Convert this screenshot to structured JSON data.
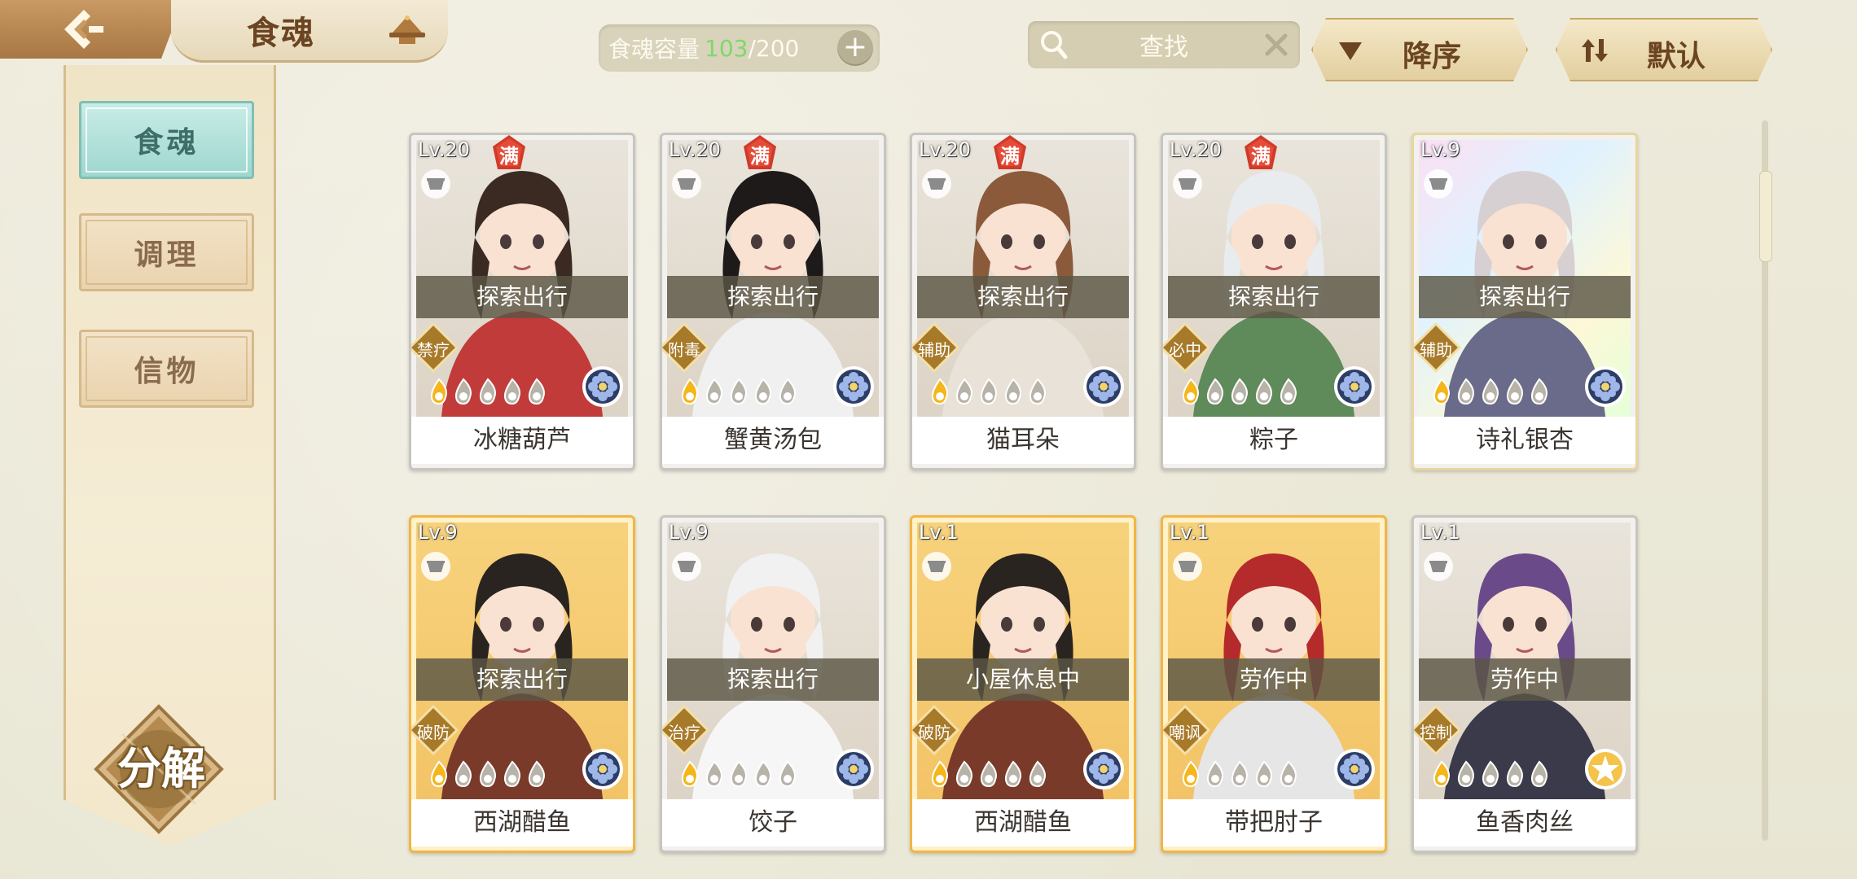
{
  "header": {
    "title": "食魂",
    "capacity_label": "食魂容量",
    "capacity_current": "103",
    "capacity_max": "/200",
    "search_placeholder": "查找",
    "sort_order_label": "降序",
    "sort_default_label": "默认"
  },
  "sidebar": {
    "items": [
      {
        "label": "食魂",
        "active": true
      },
      {
        "label": "调理",
        "active": false
      },
      {
        "label": "信物",
        "active": false
      }
    ],
    "decompose_label": "分解"
  },
  "full_badge_text": "满",
  "cards": [
    {
      "level": "Lv.20",
      "full": true,
      "status": "探索出行",
      "type": "禁疗",
      "name": "冰糖葫芦",
      "frame": "silver",
      "stars_lit": 1
    },
    {
      "level": "Lv.20",
      "full": true,
      "status": "探索出行",
      "type": "附毒",
      "name": "蟹黄汤包",
      "frame": "silver",
      "stars_lit": 1
    },
    {
      "level": "Lv.20",
      "full": true,
      "status": "探索出行",
      "type": "辅助",
      "name": "猫耳朵",
      "frame": "silver",
      "stars_lit": 1
    },
    {
      "level": "Lv.20",
      "full": true,
      "status": "探索出行",
      "type": "必中",
      "name": "粽子",
      "frame": "silver",
      "stars_lit": 1
    },
    {
      "level": "Lv.9",
      "full": false,
      "status": "探索出行",
      "type": "辅助",
      "name": "诗礼银杏",
      "frame": "rainbow",
      "stars_lit": 1
    },
    {
      "level": "Lv.9",
      "full": false,
      "status": "探索出行",
      "type": "破防",
      "name": "西湖醋鱼",
      "frame": "gold",
      "stars_lit": 1
    },
    {
      "level": "Lv.9",
      "full": false,
      "status": "探索出行",
      "type": "治疗",
      "name": "饺子",
      "frame": "silver",
      "stars_lit": 1
    },
    {
      "level": "Lv.1",
      "full": false,
      "status": "小屋休息中",
      "type": "破防",
      "name": "西湖醋鱼",
      "frame": "gold",
      "stars_lit": 1
    },
    {
      "level": "Lv.1",
      "full": false,
      "status": "劳作中",
      "type": "嘲讽",
      "name": "带把肘子",
      "frame": "gold",
      "stars_lit": 1
    },
    {
      "level": "Lv.1",
      "full": false,
      "status": "劳作中",
      "type": "控制",
      "name": "鱼香肉丝",
      "frame": "silver",
      "stars_lit": 1
    }
  ],
  "colors": {
    "accent_gold": "#c8a667",
    "active_tab": "#9ed7cf",
    "capacity_current": "#7cd96a",
    "text_brown": "#6b4422"
  },
  "icons": {
    "back": "back-arrow-icon",
    "hat": "hat-icon",
    "search": "search-icon",
    "clear": "close-icon",
    "sort_order": "triangle-down-icon",
    "sort_default": "sort-arrows-icon",
    "cup": "cup-icon",
    "orb_blue": "flower-orb-icon",
    "orb_gold": "star-orb-icon"
  }
}
